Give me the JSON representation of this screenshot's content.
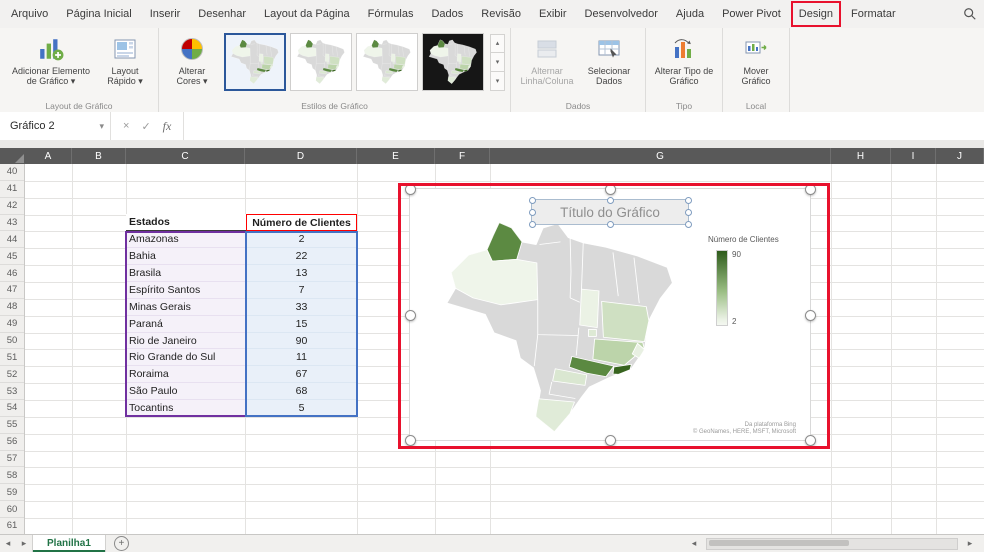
{
  "menu": {
    "tabs": [
      "Arquivo",
      "Página Inicial",
      "Inserir",
      "Desenhar",
      "Layout da Página",
      "Fórmulas",
      "Dados",
      "Revisão",
      "Exibir",
      "Desenvolvedor",
      "Ajuda",
      "Power Pivot",
      "Design",
      "Formatar"
    ],
    "highlighted_tab": "Design"
  },
  "ribbon": {
    "add_chart_element": "Adicionar Elemento de Gráfico ▾",
    "quick_layout": "Layout Rápido ▾",
    "change_colors": "Alterar Cores ▾",
    "switch_row_column": "Alternar Linha/Coluna",
    "select_data": "Selecionar Dados",
    "change_chart_type": "Alterar Tipo de Gráfico",
    "move_chart": "Mover Gráfico",
    "groups": [
      "Layout de Gráfico",
      "Estilos de Gráfico",
      "Dados",
      "Tipo",
      "Local"
    ]
  },
  "formula_bar": {
    "name_box": "Gráfico 2",
    "fx": "fx"
  },
  "glyphs": {
    "dropdown": "▾",
    "up": "▴",
    "down": "▾",
    "left": "◂",
    "right": "▸",
    "close": "×",
    "check": "✓",
    "plus": "+"
  },
  "grid": {
    "columns": [
      "A",
      "B",
      "C",
      "D",
      "E",
      "F",
      "G",
      "H",
      "I",
      "J"
    ],
    "rows": [
      40,
      41,
      42,
      43,
      44,
      45,
      46,
      47,
      48,
      49,
      50,
      51,
      52,
      53,
      54,
      55,
      56,
      57,
      58,
      59,
      60,
      61
    ]
  },
  "table": {
    "header_estado": "Estados",
    "header_clientes": "Número de Clientes",
    "rows": [
      {
        "estado": "Amazonas",
        "clientes": 2
      },
      {
        "estado": "Bahia",
        "clientes": 22
      },
      {
        "estado": "Brasila",
        "clientes": 13
      },
      {
        "estado": "Espírito Santos",
        "clientes": 7
      },
      {
        "estado": "Minas Gerais",
        "clientes": 33
      },
      {
        "estado": "Paraná",
        "clientes": 15
      },
      {
        "estado": "Rio de Janeiro",
        "clientes": 90
      },
      {
        "estado": "Rio Grande do Sul",
        "clientes": 11
      },
      {
        "estado": "Roraima",
        "clientes": 67
      },
      {
        "estado": "São Paulo",
        "clientes": 68
      },
      {
        "estado": "Tocantins",
        "clientes": 5
      }
    ]
  },
  "chart": {
    "title": "Título do Gráfico",
    "legend_title": "Número de Clientes",
    "legend_max": "90",
    "legend_min": "2",
    "attribution_line1": "Da plataforma Bing",
    "attribution_line2": "© GeoNames, HERE, MSFT, Microsoft"
  },
  "chart_data": {
    "type": "choropleth_map",
    "map_region": "Brazil states",
    "title": "Título do Gráfico",
    "legend_title": "Número de Clientes",
    "categories": [
      "Amazonas",
      "Bahia",
      "Brasila",
      "Espírito Santos",
      "Minas Gerais",
      "Paraná",
      "Rio de Janeiro",
      "Rio Grande do Sul",
      "Roraima",
      "São Paulo",
      "Tocantins"
    ],
    "values": [
      2,
      22,
      13,
      7,
      33,
      15,
      90,
      11,
      67,
      68,
      5
    ],
    "color_scale": {
      "min": 2,
      "max": 90,
      "min_color": "#f0f5ec",
      "max_color": "#38641f"
    },
    "legend_position": "right"
  },
  "sheet_bar": {
    "active_tab": "Planilha1"
  },
  "colors": {
    "annotation_red": "#e8112d",
    "excel_green": "#217346",
    "category_range_purple": "#7030a0",
    "value_range_blue": "#4472c4",
    "series_name_red": "#ff0000",
    "column_header_gray": "#595959"
  }
}
